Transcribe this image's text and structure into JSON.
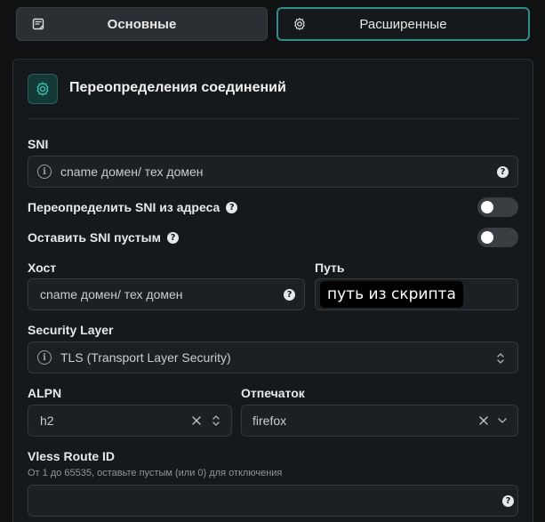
{
  "tabs": {
    "basic_label": "Основные",
    "advanced_label": "Расширенные",
    "active": "advanced"
  },
  "section": {
    "title": "Переопределения соединений"
  },
  "sni": {
    "label": "SNI",
    "placeholder": "cname домен/ тех домен"
  },
  "override_sni": {
    "label": "Переопределить SNI из адреса",
    "enabled": false
  },
  "keep_sni_empty": {
    "label": "Оставить SNI пустым",
    "enabled": false
  },
  "host": {
    "label": "Хост",
    "placeholder": "cname домен/ тех домен"
  },
  "path": {
    "label": "Путь",
    "tooltip": "путь из скрипта"
  },
  "security_layer": {
    "label": "Security Layer",
    "value": "TLS (Transport Layer Security)"
  },
  "alpn": {
    "label": "ALPN",
    "value": "h2"
  },
  "fingerprint": {
    "label": "Отпечаток",
    "value": "firefox"
  },
  "vless_route": {
    "label": "Vless Route ID",
    "hint": "От 1 до 65535, оставьте пустым (или 0) для отключения",
    "value": ""
  },
  "colors": {
    "accent": "#2e8f8a",
    "background": "#0f1113",
    "panel": "#16191c"
  }
}
